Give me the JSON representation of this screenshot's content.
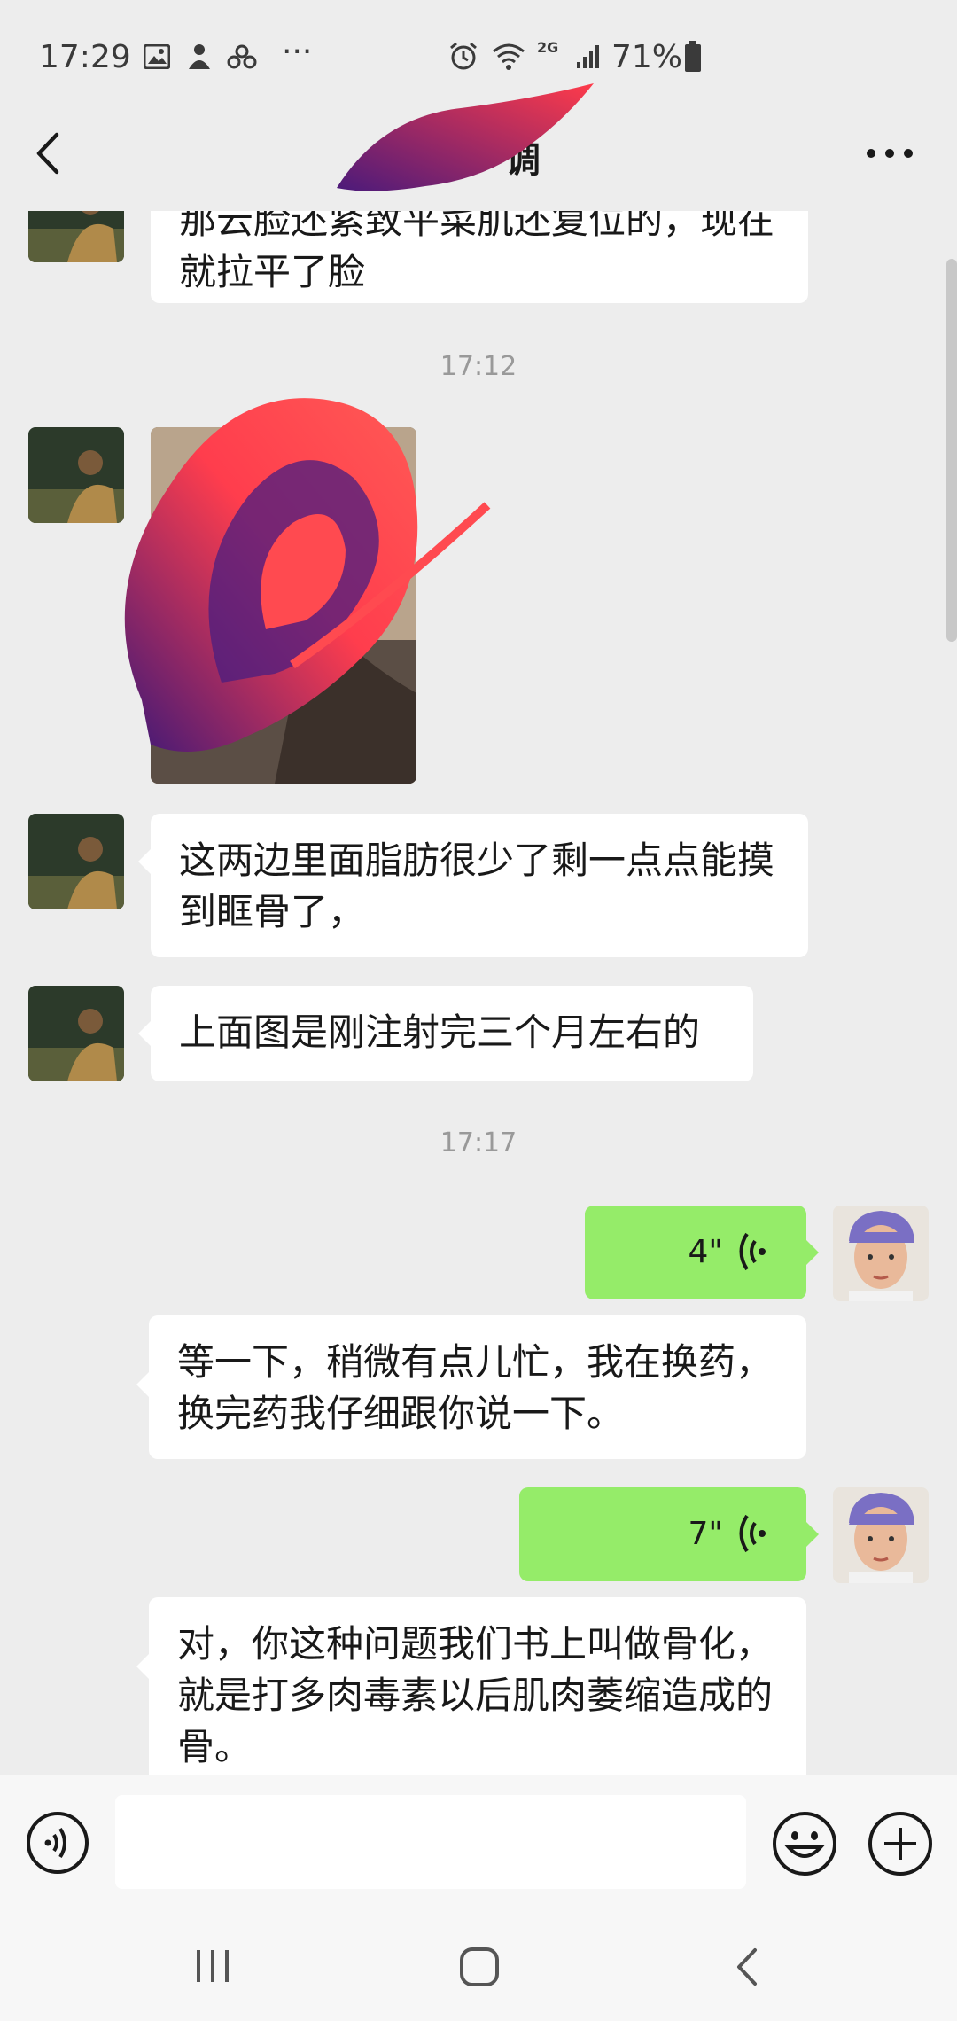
{
  "status_bar": {
    "time": "17:29",
    "network": "2G",
    "battery": "71%",
    "more": "···"
  },
  "nav": {
    "title_visible": "调"
  },
  "messages": {
    "m1_text": "那云脸还紧致平菜肌还复位的，现在就拉平了脸",
    "ts1": "17:12",
    "m2_text": "这两边里面脂肪很少了剩一点点能摸到眶骨了，",
    "m3_text": "上面图是刚注射完三个月左右的",
    "ts2": "17:17",
    "voice1_duration": "4\"",
    "m4_text": "等一下，稍微有点儿忙，我在换药，换完药我仔细跟你说一下。",
    "voice2_duration": "7\"",
    "m5_text": "对，你这种问题我们书上叫做骨化，就是打多肉毒素以后肌肉萎缩造成的骨。"
  },
  "colors": {
    "my_bubble": "#95ec69",
    "other_bubble": "#ffffff",
    "background": "#ededed"
  },
  "icons": [
    "back-icon",
    "more-icon",
    "voice-input-icon",
    "emoji-icon",
    "plus-icon",
    "voice-wave-icon"
  ]
}
